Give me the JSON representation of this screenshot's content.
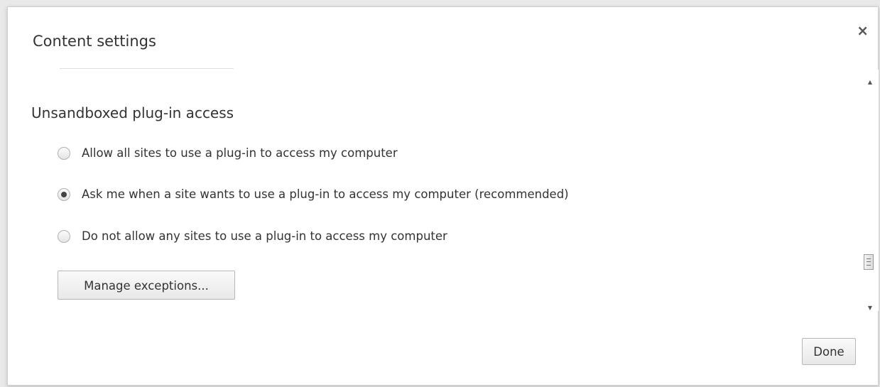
{
  "dialog": {
    "title": "Content settings",
    "close_icon": "×"
  },
  "section": {
    "title": "Unsandboxed plug-in access",
    "options": [
      {
        "label": "Allow all sites to use a plug-in to access my computer",
        "checked": false
      },
      {
        "label": "Ask me when a site wants to use a plug-in to access my computer (recommended)",
        "checked": true
      },
      {
        "label": "Do not allow any sites to use a plug-in to access my computer",
        "checked": false
      }
    ],
    "manage_button": "Manage exceptions..."
  },
  "footer": {
    "done_button": "Done"
  },
  "scrollbar": {
    "up_arrow": "▲",
    "down_arrow": "▼"
  }
}
